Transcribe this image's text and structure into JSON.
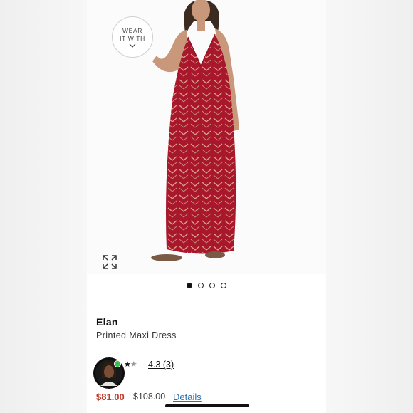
{
  "wear_button": {
    "line1": "WEAR",
    "line2": "IT WITH",
    "icon": "chevron-down-icon"
  },
  "gallery": {
    "expand_icon": "expand-arrows-icon",
    "total_images": 4,
    "active_index": 0
  },
  "product": {
    "brand": "Elan",
    "name": "Printed Maxi Dress",
    "dress_color": "#a8172b"
  },
  "review": {
    "stars_text": "★",
    "half_star": "★",
    "rating_text": "4.3 (3)",
    "rating_value": 4.3
  },
  "pricing": {
    "sale": "$81.00",
    "original": "$108.00",
    "details_link": "Details",
    "sale_color": "#c0392b"
  }
}
